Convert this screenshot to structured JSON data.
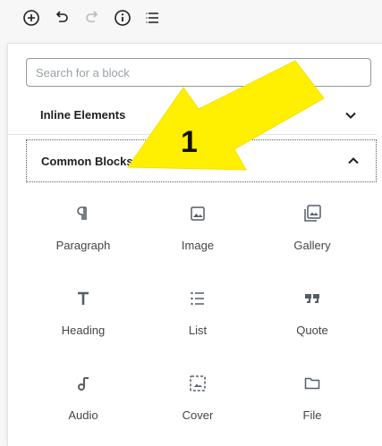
{
  "toolbar": {
    "icons": [
      "add-icon",
      "undo-icon",
      "redo-icon",
      "info-icon",
      "list-view-icon"
    ]
  },
  "inserter": {
    "search_placeholder": "Search for a block",
    "sections": [
      {
        "label": "Inline Elements",
        "state": "collapsed"
      },
      {
        "label": "Common Blocks",
        "state": "expanded"
      }
    ],
    "blocks": [
      {
        "label": "Paragraph",
        "icon": "paragraph-icon"
      },
      {
        "label": "Image",
        "icon": "image-icon"
      },
      {
        "label": "Gallery",
        "icon": "gallery-icon"
      },
      {
        "label": "Heading",
        "icon": "heading-icon"
      },
      {
        "label": "List",
        "icon": "list-icon"
      },
      {
        "label": "Quote",
        "icon": "quote-icon"
      },
      {
        "label": "Audio",
        "icon": "audio-icon"
      },
      {
        "label": "Cover",
        "icon": "cover-icon"
      },
      {
        "label": "File",
        "icon": "file-icon"
      }
    ]
  },
  "annotation": {
    "number": "1",
    "arrow_color": "#ffef00"
  }
}
